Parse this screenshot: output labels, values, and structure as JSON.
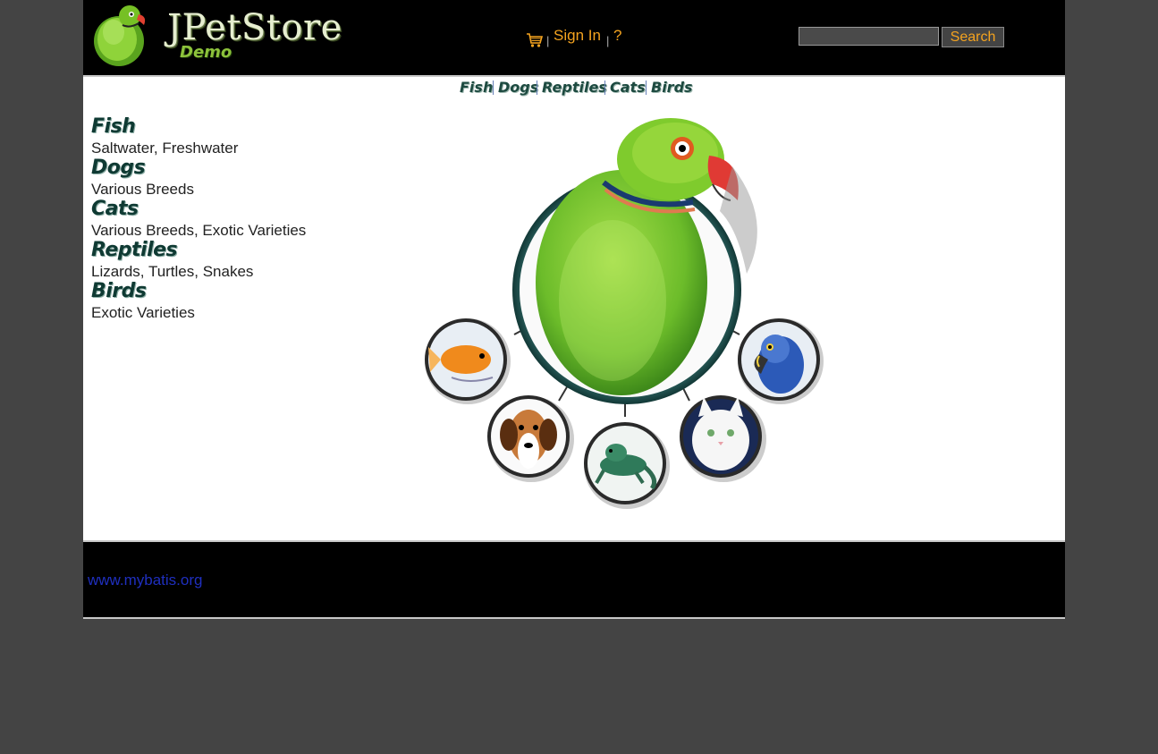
{
  "header": {
    "logo_title": "JPetStore",
    "logo_subtitle": "Demo",
    "menu": {
      "cart_icon": "shopping-cart-icon",
      "sign_in": "Sign In",
      "help": "?"
    },
    "search": {
      "value": "",
      "button_label": "Search"
    }
  },
  "quick_links": [
    "Fish",
    "Dogs",
    "Reptiles",
    "Cats",
    "Birds"
  ],
  "sidebar": {
    "categories": [
      {
        "name": "Fish",
        "description": "Saltwater, Freshwater"
      },
      {
        "name": "Dogs",
        "description": "Various Breeds"
      },
      {
        "name": "Cats",
        "description": "Various Breeds, Exotic Varieties"
      },
      {
        "name": "Reptiles",
        "description": "Lizards, Turtles, Snakes"
      },
      {
        "name": "Birds",
        "description": "Exotic Varieties"
      }
    ]
  },
  "main_image": {
    "center": "parrot",
    "satellites": [
      "fish",
      "dog",
      "reptile",
      "cat",
      "bird"
    ]
  },
  "footer": {
    "link": "www.mybatis.org"
  },
  "colors": {
    "page_background": "#444444",
    "header_background": "#000000",
    "menu_link": "#f4a31f",
    "footer_link": "#1f2fbf",
    "category_title": "#0f3a33"
  }
}
